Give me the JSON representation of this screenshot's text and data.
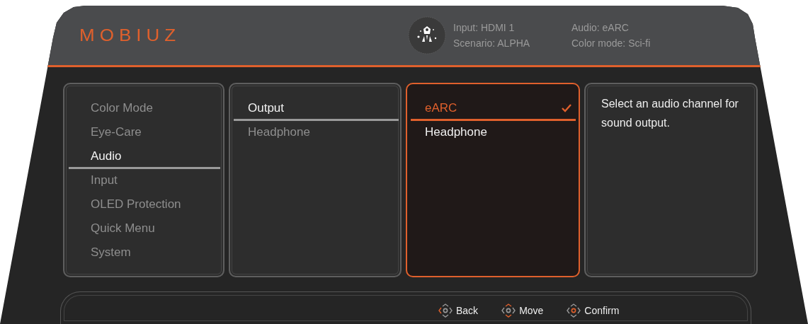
{
  "header": {
    "logo": "MOBIUZ",
    "info": [
      {
        "label": "Input: HDMI 1"
      },
      {
        "label": "Scenario: ALPHA"
      },
      {
        "label": "Audio: eARC"
      },
      {
        "label": "Color mode: Sci-fi"
      }
    ]
  },
  "main_menu": {
    "focused": false,
    "items": [
      {
        "label": "Color Mode",
        "selected": false
      },
      {
        "label": "Eye-Care",
        "selected": false
      },
      {
        "label": "Audio",
        "selected": true
      },
      {
        "label": "Input",
        "selected": false
      },
      {
        "label": "OLED Protection",
        "selected": false
      },
      {
        "label": "Quick Menu",
        "selected": false
      },
      {
        "label": "System",
        "selected": false
      }
    ]
  },
  "sub_menu": {
    "focused": false,
    "items": [
      {
        "label": "Output",
        "selected": true
      },
      {
        "label": "Headphone",
        "selected": false
      }
    ]
  },
  "options": {
    "focused": true,
    "items": [
      {
        "label": "eARC",
        "selected": true,
        "checked": true
      },
      {
        "label": "Headphone",
        "selected": false,
        "checked": false
      }
    ]
  },
  "description": "Select an audio channel for sound output.",
  "footer": {
    "hints": [
      {
        "kind": "back",
        "label": "Back"
      },
      {
        "kind": "move",
        "label": "Move"
      },
      {
        "kind": "confirm",
        "label": "Confirm"
      }
    ]
  }
}
